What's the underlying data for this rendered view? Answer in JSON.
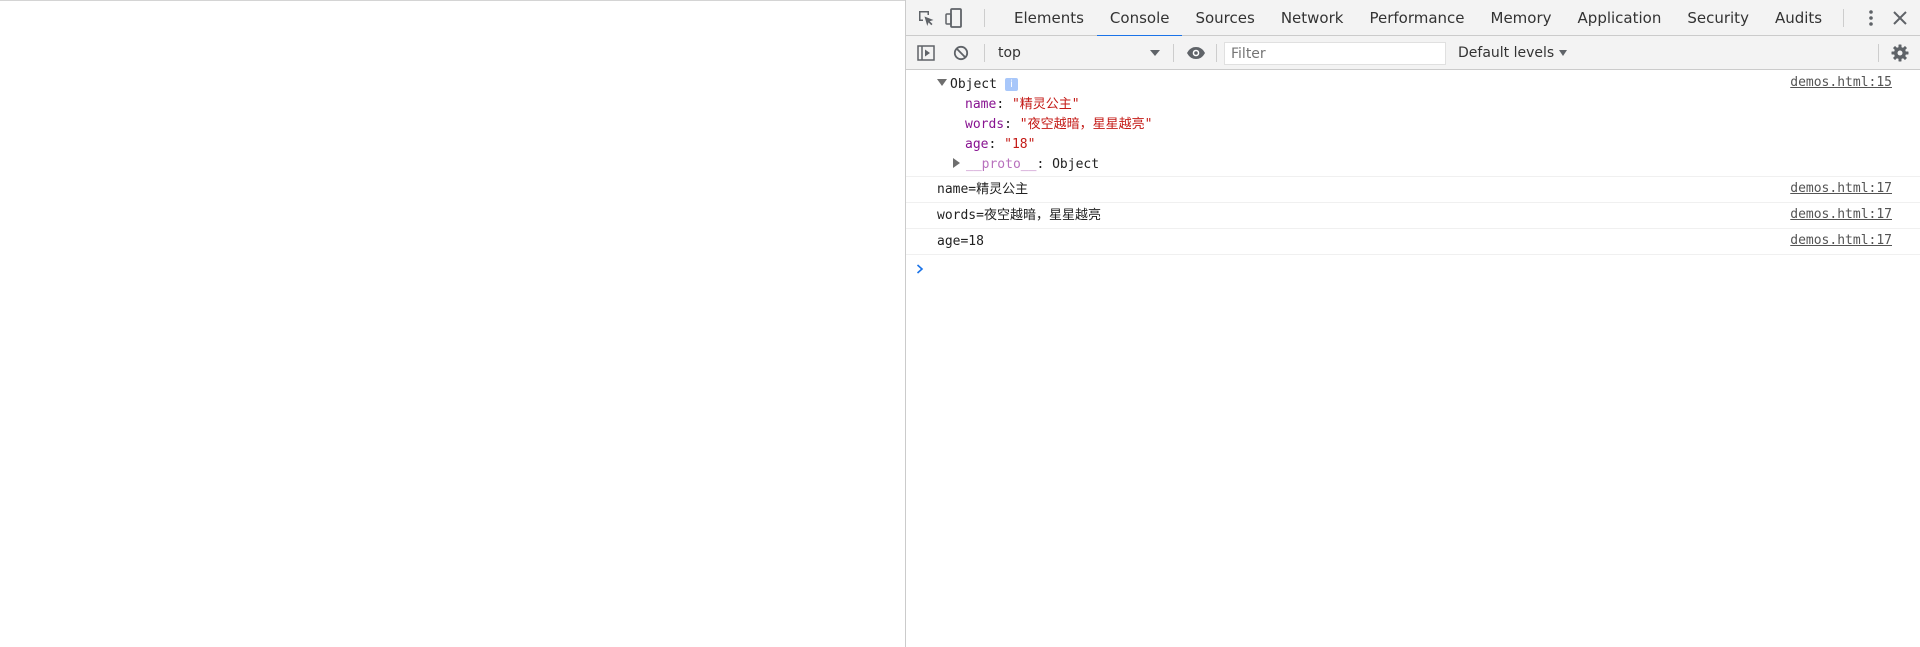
{
  "tabs": [
    {
      "label": "Elements",
      "selected": false
    },
    {
      "label": "Console",
      "selected": true
    },
    {
      "label": "Sources",
      "selected": false
    },
    {
      "label": "Network",
      "selected": false
    },
    {
      "label": "Performance",
      "selected": false
    },
    {
      "label": "Memory",
      "selected": false
    },
    {
      "label": "Application",
      "selected": false
    },
    {
      "label": "Security",
      "selected": false
    },
    {
      "label": "Audits",
      "selected": false
    }
  ],
  "toolbar": {
    "context": "top",
    "filter_placeholder": "Filter",
    "levels_label": "Default levels"
  },
  "messages": {
    "object_message": {
      "label": "Object",
      "badge": "i",
      "source": "demos.html:15",
      "props": [
        {
          "key": "name",
          "value": "\"精灵公主\""
        },
        {
          "key": "words",
          "value": "\"夜空越暗，星星越亮\""
        },
        {
          "key": "age",
          "value": "\"18\""
        }
      ],
      "proto_key": "__proto__",
      "proto_value": "Object"
    },
    "log_1": {
      "text": "name=精灵公主",
      "source": "demos.html:17"
    },
    "log_2": {
      "text": "words=夜空越暗，星星越亮",
      "source": "demos.html:17"
    },
    "log_3": {
      "text": "age=18",
      "source": "demos.html:17"
    }
  },
  "colors": {
    "accent": "#1a73e8",
    "string": "#c41a16",
    "property": "#881391"
  }
}
